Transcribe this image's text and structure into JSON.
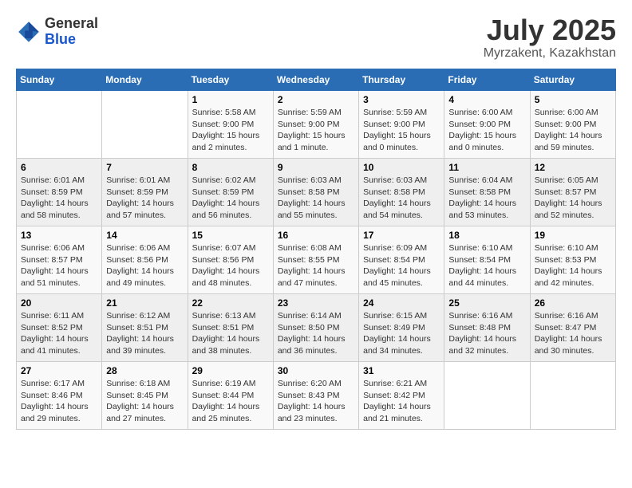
{
  "header": {
    "logo_general": "General",
    "logo_blue": "Blue",
    "month": "July 2025",
    "location": "Myrzakent, Kazakhstan"
  },
  "weekdays": [
    "Sunday",
    "Monday",
    "Tuesday",
    "Wednesday",
    "Thursday",
    "Friday",
    "Saturday"
  ],
  "weeks": [
    [
      {
        "num": "",
        "info": ""
      },
      {
        "num": "",
        "info": ""
      },
      {
        "num": "1",
        "info": "Sunrise: 5:58 AM\nSunset: 9:00 PM\nDaylight: 15 hours and 2 minutes."
      },
      {
        "num": "2",
        "info": "Sunrise: 5:59 AM\nSunset: 9:00 PM\nDaylight: 15 hours and 1 minute."
      },
      {
        "num": "3",
        "info": "Sunrise: 5:59 AM\nSunset: 9:00 PM\nDaylight: 15 hours and 0 minutes."
      },
      {
        "num": "4",
        "info": "Sunrise: 6:00 AM\nSunset: 9:00 PM\nDaylight: 15 hours and 0 minutes."
      },
      {
        "num": "5",
        "info": "Sunrise: 6:00 AM\nSunset: 9:00 PM\nDaylight: 14 hours and 59 minutes."
      }
    ],
    [
      {
        "num": "6",
        "info": "Sunrise: 6:01 AM\nSunset: 8:59 PM\nDaylight: 14 hours and 58 minutes."
      },
      {
        "num": "7",
        "info": "Sunrise: 6:01 AM\nSunset: 8:59 PM\nDaylight: 14 hours and 57 minutes."
      },
      {
        "num": "8",
        "info": "Sunrise: 6:02 AM\nSunset: 8:59 PM\nDaylight: 14 hours and 56 minutes."
      },
      {
        "num": "9",
        "info": "Sunrise: 6:03 AM\nSunset: 8:58 PM\nDaylight: 14 hours and 55 minutes."
      },
      {
        "num": "10",
        "info": "Sunrise: 6:03 AM\nSunset: 8:58 PM\nDaylight: 14 hours and 54 minutes."
      },
      {
        "num": "11",
        "info": "Sunrise: 6:04 AM\nSunset: 8:58 PM\nDaylight: 14 hours and 53 minutes."
      },
      {
        "num": "12",
        "info": "Sunrise: 6:05 AM\nSunset: 8:57 PM\nDaylight: 14 hours and 52 minutes."
      }
    ],
    [
      {
        "num": "13",
        "info": "Sunrise: 6:06 AM\nSunset: 8:57 PM\nDaylight: 14 hours and 51 minutes."
      },
      {
        "num": "14",
        "info": "Sunrise: 6:06 AM\nSunset: 8:56 PM\nDaylight: 14 hours and 49 minutes."
      },
      {
        "num": "15",
        "info": "Sunrise: 6:07 AM\nSunset: 8:56 PM\nDaylight: 14 hours and 48 minutes."
      },
      {
        "num": "16",
        "info": "Sunrise: 6:08 AM\nSunset: 8:55 PM\nDaylight: 14 hours and 47 minutes."
      },
      {
        "num": "17",
        "info": "Sunrise: 6:09 AM\nSunset: 8:54 PM\nDaylight: 14 hours and 45 minutes."
      },
      {
        "num": "18",
        "info": "Sunrise: 6:10 AM\nSunset: 8:54 PM\nDaylight: 14 hours and 44 minutes."
      },
      {
        "num": "19",
        "info": "Sunrise: 6:10 AM\nSunset: 8:53 PM\nDaylight: 14 hours and 42 minutes."
      }
    ],
    [
      {
        "num": "20",
        "info": "Sunrise: 6:11 AM\nSunset: 8:52 PM\nDaylight: 14 hours and 41 minutes."
      },
      {
        "num": "21",
        "info": "Sunrise: 6:12 AM\nSunset: 8:51 PM\nDaylight: 14 hours and 39 minutes."
      },
      {
        "num": "22",
        "info": "Sunrise: 6:13 AM\nSunset: 8:51 PM\nDaylight: 14 hours and 38 minutes."
      },
      {
        "num": "23",
        "info": "Sunrise: 6:14 AM\nSunset: 8:50 PM\nDaylight: 14 hours and 36 minutes."
      },
      {
        "num": "24",
        "info": "Sunrise: 6:15 AM\nSunset: 8:49 PM\nDaylight: 14 hours and 34 minutes."
      },
      {
        "num": "25",
        "info": "Sunrise: 6:16 AM\nSunset: 8:48 PM\nDaylight: 14 hours and 32 minutes."
      },
      {
        "num": "26",
        "info": "Sunrise: 6:16 AM\nSunset: 8:47 PM\nDaylight: 14 hours and 30 minutes."
      }
    ],
    [
      {
        "num": "27",
        "info": "Sunrise: 6:17 AM\nSunset: 8:46 PM\nDaylight: 14 hours and 29 minutes."
      },
      {
        "num": "28",
        "info": "Sunrise: 6:18 AM\nSunset: 8:45 PM\nDaylight: 14 hours and 27 minutes."
      },
      {
        "num": "29",
        "info": "Sunrise: 6:19 AM\nSunset: 8:44 PM\nDaylight: 14 hours and 25 minutes."
      },
      {
        "num": "30",
        "info": "Sunrise: 6:20 AM\nSunset: 8:43 PM\nDaylight: 14 hours and 23 minutes."
      },
      {
        "num": "31",
        "info": "Sunrise: 6:21 AM\nSunset: 8:42 PM\nDaylight: 14 hours and 21 minutes."
      },
      {
        "num": "",
        "info": ""
      },
      {
        "num": "",
        "info": ""
      }
    ]
  ]
}
